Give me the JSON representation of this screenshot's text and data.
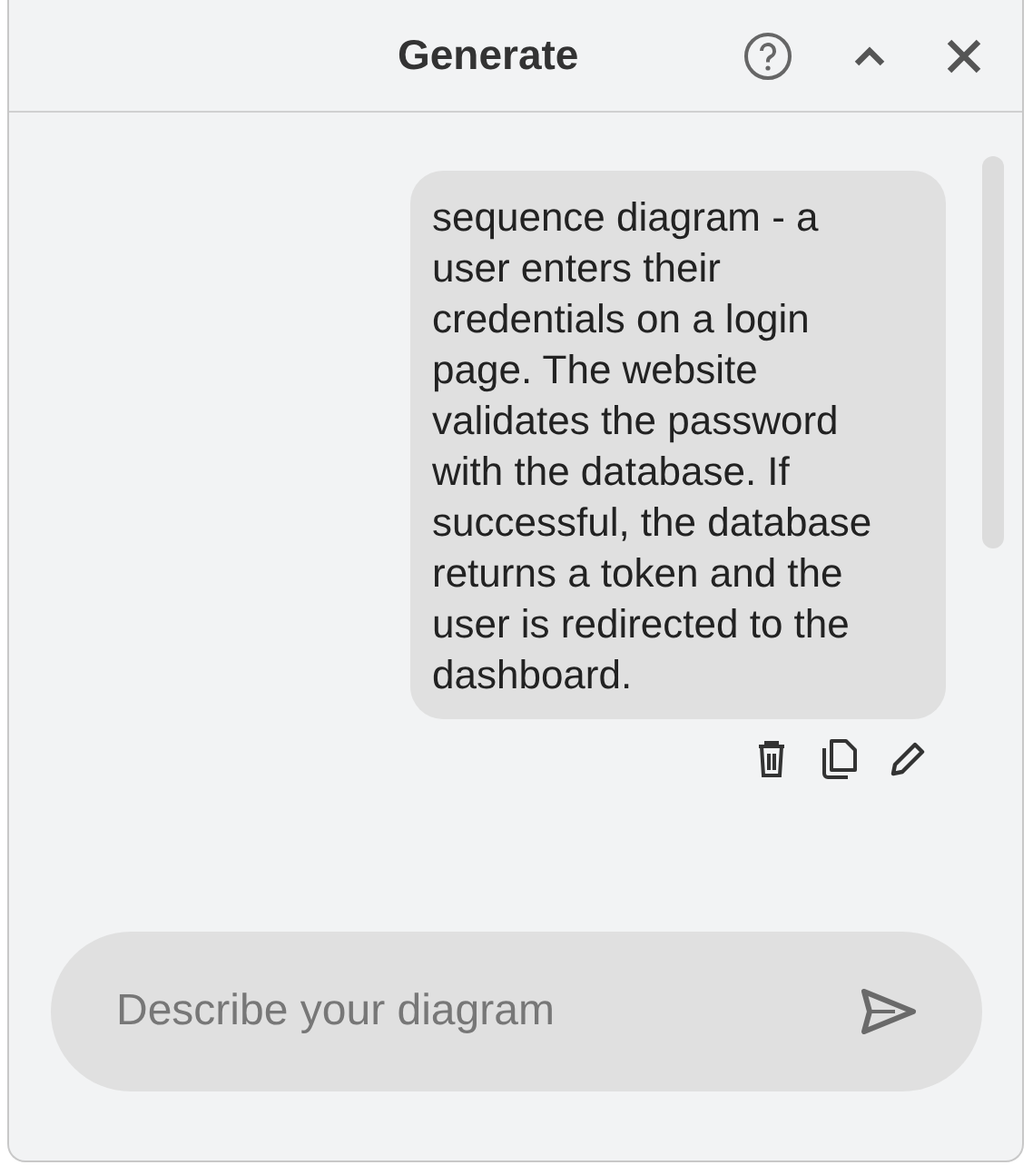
{
  "window": {
    "title": "Generate"
  },
  "messages": [
    {
      "text": "sequence diagram - a user enters their credentials on a login page. The website validates the password with the database. If successful, the database returns a token and the user is redirected to the dashboard."
    }
  ],
  "input": {
    "placeholder": "Describe your diagram"
  }
}
